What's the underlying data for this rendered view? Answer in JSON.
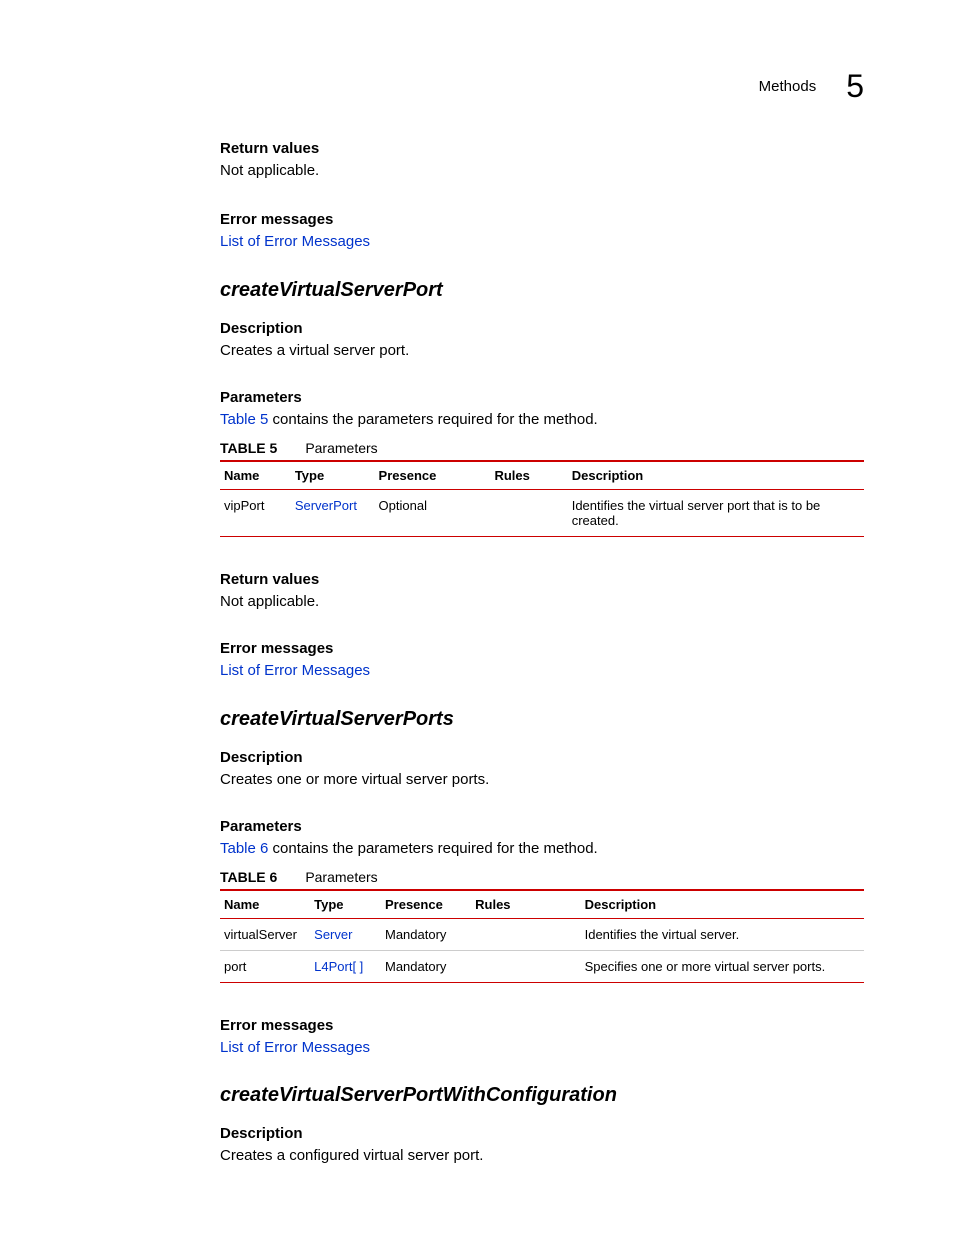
{
  "header": {
    "section": "Methods",
    "chapter": "5"
  },
  "block1": {
    "return_heading": "Return values",
    "return_text": "Not applicable.",
    "error_heading": "Error messages",
    "error_link": "List of Error Messages"
  },
  "method1": {
    "title": "createVirtualServerPort",
    "desc_heading": "Description",
    "desc_text": "Creates a virtual server port.",
    "param_heading": "Parameters",
    "param_intro_link": "Table 5",
    "param_intro_rest": " contains the parameters required for the method.",
    "table_label": "TABLE 5",
    "table_title": "Parameters",
    "cols": {
      "name": "Name",
      "type": "Type",
      "presence": "Presence",
      "rules": "Rules",
      "desc": "Description"
    },
    "rows": [
      {
        "name": "vipPort",
        "type": "ServerPort",
        "presence": "Optional",
        "rules": "",
        "desc": "Identifies the virtual server port that is to be created."
      }
    ],
    "return_heading": "Return values",
    "return_text": "Not applicable.",
    "error_heading": "Error messages",
    "error_link": "List of Error Messages"
  },
  "method2": {
    "title": "createVirtualServerPorts",
    "desc_heading": "Description",
    "desc_text": "Creates one or more virtual server ports.",
    "param_heading": "Parameters",
    "param_intro_link": "Table 6",
    "param_intro_rest": " contains the parameters required for the method.",
    "table_label": "TABLE 6",
    "table_title": "Parameters",
    "cols": {
      "name": "Name",
      "type": "Type",
      "presence": "Presence",
      "rules": "Rules",
      "desc": "Description"
    },
    "rows": [
      {
        "name": "virtualServer",
        "type": "Server",
        "presence": "Mandatory",
        "rules": "",
        "desc": "Identifies the virtual server."
      },
      {
        "name": "port",
        "type": "L4Port[ ]",
        "presence": "Mandatory",
        "rules": "",
        "desc": "Specifies one or more virtual server ports."
      }
    ],
    "error_heading": "Error messages",
    "error_link": "List of Error Messages"
  },
  "method3": {
    "title": "createVirtualServerPortWithConfiguration",
    "desc_heading": "Description",
    "desc_text": "Creates a configured virtual server port."
  }
}
